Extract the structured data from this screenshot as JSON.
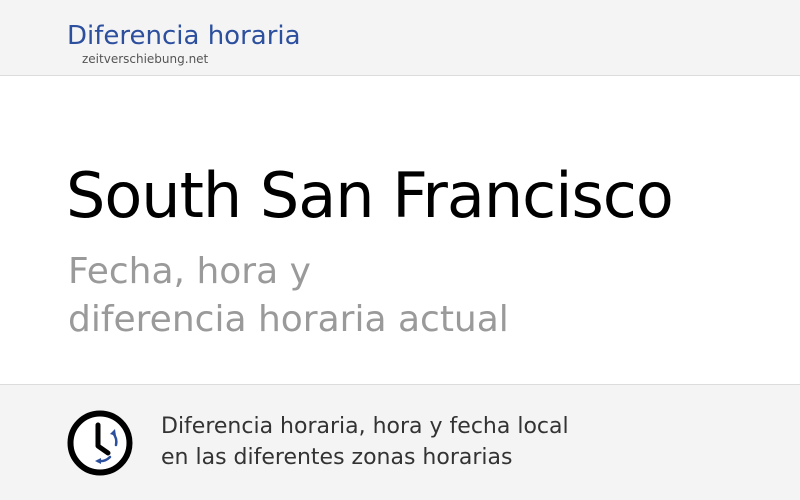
{
  "header": {
    "brand_title": "Diferencia horaria",
    "brand_domain": "zeitverschiebung.net"
  },
  "main": {
    "city": "South San Francisco",
    "subtitle_line1": "Fecha, hora y",
    "subtitle_line2": "diferencia horaria actual"
  },
  "footer": {
    "icon": "clock-icon",
    "line1": "Diferencia horaria, hora y fecha local",
    "line2": "en las diferentes zonas horarias"
  },
  "colors": {
    "brand": "#2c4f9e",
    "header_bg": "#f4f4f4",
    "subtitle": "#9a9a9a",
    "icon_arrows": "#2c4f9e"
  }
}
